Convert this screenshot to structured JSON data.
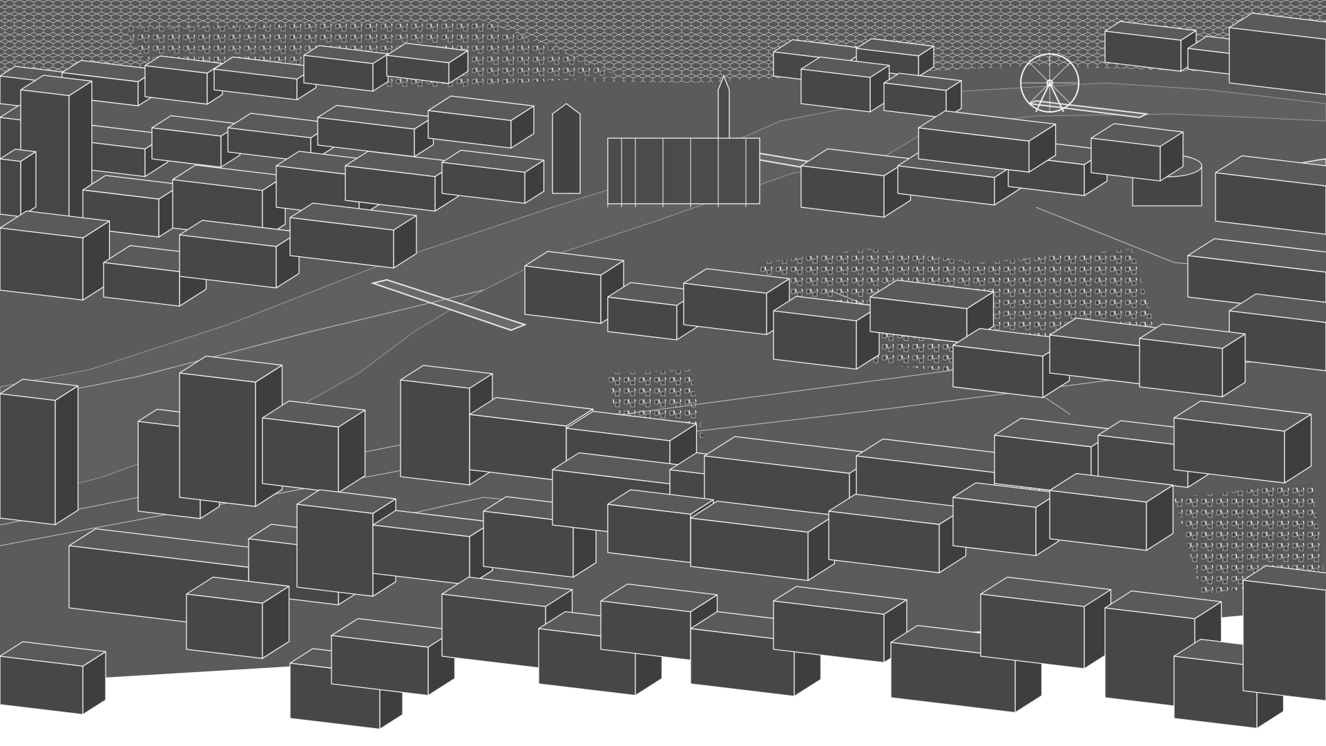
{
  "scene": {
    "subject": "3d-city-model-render",
    "colors": {
      "ground": "#5b5b5b",
      "river": "#5f5f5f",
      "building_top": "#5a5a5a",
      "building_left": "#474747",
      "building_right": "#3e3e3e",
      "edge": "#f2f2f2",
      "void": "#ffffff",
      "street": "#d9d9d9"
    },
    "labels": []
  }
}
